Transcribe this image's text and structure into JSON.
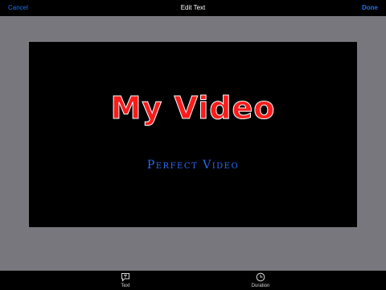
{
  "navbar": {
    "cancel_label": "Cancel",
    "title": "Edit Text",
    "done_label": "Done"
  },
  "canvas": {
    "title_text": "My Video",
    "title_color": "#ff1a1a",
    "subtitle_text": "Perfect Video",
    "subtitle_color": "#2a6cf5"
  },
  "tabbar": {
    "tabs": [
      {
        "label": "Text",
        "icon": "text-bubble-icon"
      },
      {
        "label": "Duration",
        "icon": "clock-icon"
      }
    ]
  },
  "colors": {
    "accent": "#1a73e8",
    "background": "#77777d",
    "bars": "#000000"
  }
}
